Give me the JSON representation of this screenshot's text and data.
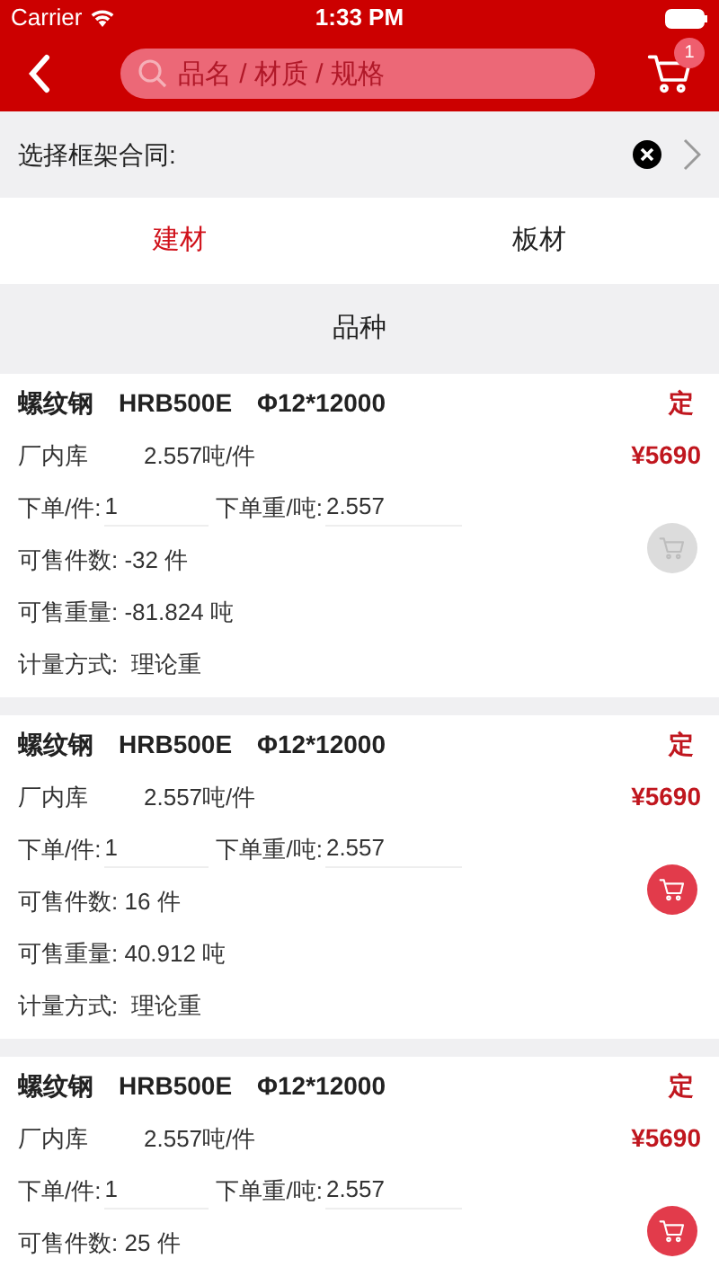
{
  "status_bar": {
    "carrier": "Carrier",
    "time": "1:33 PM"
  },
  "nav": {
    "search_placeholder": "品名 / 材质 / 规格",
    "cart_badge": "1"
  },
  "contract": {
    "label": "选择框架合同:"
  },
  "tabs": [
    {
      "label": "建材",
      "selected": true
    },
    {
      "label": "板材",
      "selected": false
    }
  ],
  "section_title": "品种",
  "products": [
    {
      "name": "螺纹钢",
      "grade": "HRB500E",
      "spec": "Φ12*12000",
      "tag": "定",
      "warehouse": "厂内库",
      "unit_weight": "2.557吨/件",
      "price": "¥5690",
      "qty_label": "下单/件:",
      "qty": "1",
      "weight_label": "下单重/吨:",
      "weight": "2.557",
      "cart_enabled": false,
      "available_count": "可售件数: -32 件",
      "available_weight": "可售重量: -81.824 吨",
      "method": "计量方式:  理论重"
    },
    {
      "name": "螺纹钢",
      "grade": "HRB500E",
      "spec": "Φ12*12000",
      "tag": "定",
      "warehouse": "厂内库",
      "unit_weight": "2.557吨/件",
      "price": "¥5690",
      "qty_label": "下单/件:",
      "qty": "1",
      "weight_label": "下单重/吨:",
      "weight": "2.557",
      "cart_enabled": true,
      "available_count": "可售件数: 16 件",
      "available_weight": "可售重量: 40.912 吨",
      "method": "计量方式:  理论重"
    },
    {
      "name": "螺纹钢",
      "grade": "HRB500E",
      "spec": "Φ12*12000",
      "tag": "定",
      "warehouse": "厂内库",
      "unit_weight": "2.557吨/件",
      "price": "¥5690",
      "qty_label": "下单/件:",
      "qty": "1",
      "weight_label": "下单重/吨:",
      "weight": "2.557",
      "cart_enabled": true,
      "available_count": "可售件数: 25 件"
    }
  ]
}
